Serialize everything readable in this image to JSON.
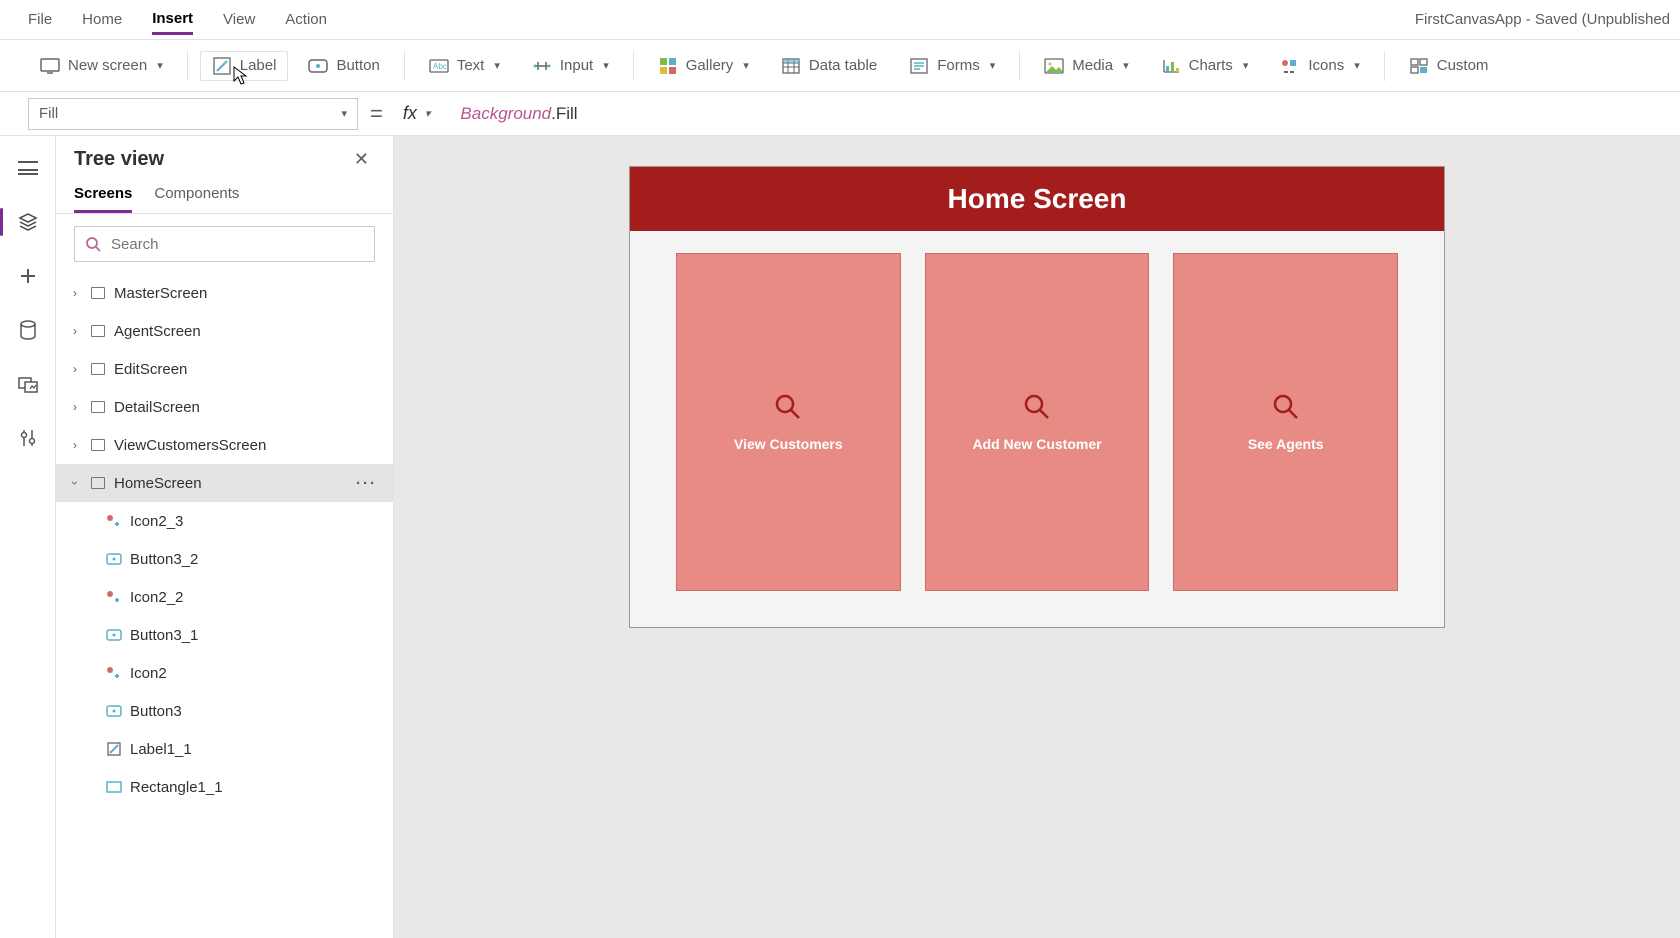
{
  "menu": {
    "file": "File",
    "home": "Home",
    "insert": "Insert",
    "view": "View",
    "action": "Action",
    "app_title": "FirstCanvasApp - Saved (Unpublished"
  },
  "ribbon": {
    "new_screen": "New screen",
    "label": "Label",
    "button": "Button",
    "text": "Text",
    "input": "Input",
    "gallery": "Gallery",
    "data_table": "Data table",
    "forms": "Forms",
    "media": "Media",
    "charts": "Charts",
    "icons": "Icons",
    "custom": "Custom"
  },
  "formula": {
    "property": "Fill",
    "obj": "Background",
    "prop": ".Fill"
  },
  "panel": {
    "title": "Tree view",
    "tab_screens": "Screens",
    "tab_components": "Components",
    "search_placeholder": "Search"
  },
  "tree": {
    "s0": "MasterScreen",
    "s1": "AgentScreen",
    "s2": "EditScreen",
    "s3": "DetailScreen",
    "s4": "ViewCustomersScreen",
    "s5": "HomeScreen",
    "c0": "Icon2_3",
    "c1": "Button3_2",
    "c2": "Icon2_2",
    "c3": "Button3_1",
    "c4": "Icon2",
    "c5": "Button3",
    "c6": "Label1_1",
    "c7": "Rectangle1_1"
  },
  "device": {
    "header": "Home Screen",
    "card0": "View Customers",
    "card1": "Add New Customer",
    "card2": "See Agents"
  }
}
